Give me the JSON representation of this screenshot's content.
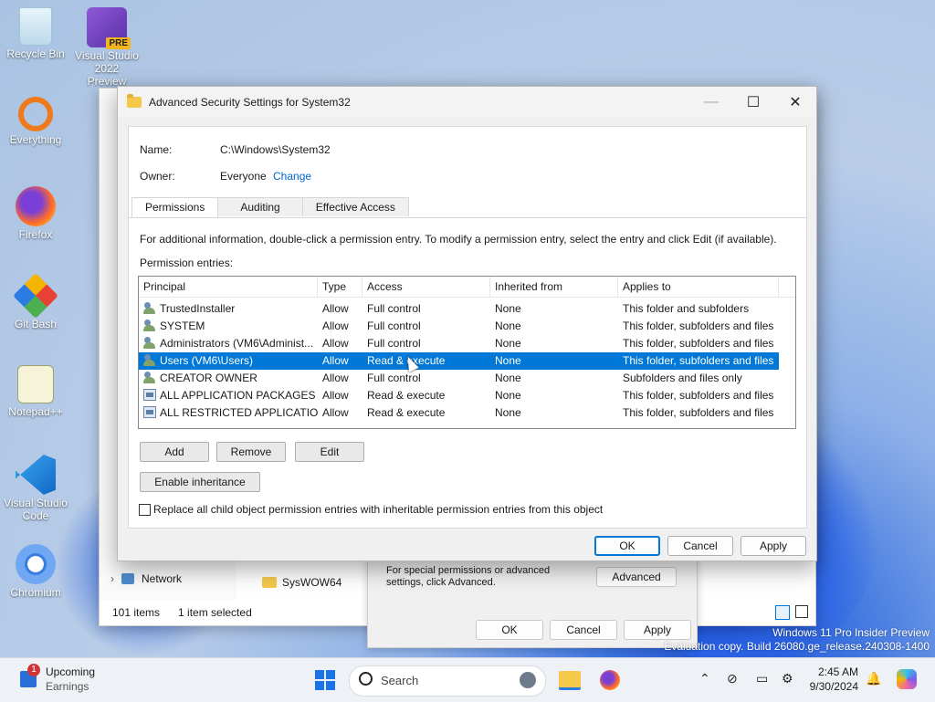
{
  "desktop": {
    "icons": [
      {
        "label": "Recycle Bin",
        "icon": "recycle-bin-icon"
      },
      {
        "label": "Visual Studio 2022 Preview",
        "icon": "visual-studio-icon",
        "badge": "PRE"
      },
      {
        "label": "Everything",
        "icon": "everything-search-icon"
      },
      {
        "label": "Firefox",
        "icon": "firefox-icon"
      },
      {
        "label": "Git Bash",
        "icon": "git-bash-icon"
      },
      {
        "label": "Notepad++",
        "icon": "notepad-plus-plus-icon"
      },
      {
        "label": "Visual Studio Code",
        "icon": "vscode-icon"
      },
      {
        "label": "Chromium",
        "icon": "chromium-icon"
      }
    ],
    "watermark_line1": "Windows 11 Pro Insider Preview",
    "watermark_line2": "Evaluation copy. Build 26080.ge_release.240308-1400"
  },
  "explorer": {
    "nav_network": "Network",
    "folder_item": "SysWOW64",
    "status_items": "101 items",
    "status_selected": "1 item selected"
  },
  "properties": {
    "hint": "For special permissions or advanced settings, click Advanced.",
    "advanced_label": "Advanced",
    "ok_label": "OK",
    "cancel_label": "Cancel",
    "apply_label": "Apply"
  },
  "dialog": {
    "title": "Advanced Security Settings for System32",
    "name_label": "Name:",
    "name_value": "C:\\Windows\\System32",
    "owner_label": "Owner:",
    "owner_value": "Everyone",
    "change_link": "Change",
    "tabs": [
      {
        "label": "Permissions",
        "active": true
      },
      {
        "label": "Auditing",
        "active": false
      },
      {
        "label": "Effective Access",
        "active": false
      }
    ],
    "info_text": "For additional information, double-click a permission entry. To modify a permission entry, select the entry and click Edit (if available).",
    "entries_label": "Permission entries:",
    "columns": [
      "Principal",
      "Type",
      "Access",
      "Inherited from",
      "Applies to"
    ],
    "rows": [
      {
        "principal": "TrustedInstaller",
        "type": "Allow",
        "access": "Full control",
        "inherited": "None",
        "applies": "This folder and subfolders",
        "icon": "user-group-icon"
      },
      {
        "principal": "SYSTEM",
        "type": "Allow",
        "access": "Full control",
        "inherited": "None",
        "applies": "This folder, subfolders and files",
        "icon": "user-group-icon"
      },
      {
        "principal": "Administrators (VM6\\Administ...",
        "type": "Allow",
        "access": "Full control",
        "inherited": "None",
        "applies": "This folder, subfolders and files",
        "icon": "user-group-icon"
      },
      {
        "principal": "Users (VM6\\Users)",
        "type": "Allow",
        "access": "Read & execute",
        "inherited": "None",
        "applies": "This folder, subfolders and files",
        "icon": "user-group-icon",
        "selected": true
      },
      {
        "principal": "CREATOR OWNER",
        "type": "Allow",
        "access": "Full control",
        "inherited": "None",
        "applies": "Subfolders and files only",
        "icon": "user-group-icon"
      },
      {
        "principal": "ALL APPLICATION PACKAGES",
        "type": "Allow",
        "access": "Read & execute",
        "inherited": "None",
        "applies": "This folder, subfolders and files",
        "icon": "package-icon"
      },
      {
        "principal": "ALL RESTRICTED APPLICATIO...",
        "type": "Allow",
        "access": "Read & execute",
        "inherited": "None",
        "applies": "This folder, subfolders and files",
        "icon": "package-icon"
      }
    ],
    "add_label": "Add",
    "remove_label": "Remove",
    "edit_label": "Edit",
    "enable_inheritance_label": "Enable inheritance",
    "replace_label": "Replace all child object permission entries with inheritable permission entries from this object",
    "ok_label": "OK",
    "cancel_label": "Cancel",
    "apply_label": "Apply"
  },
  "taskbar": {
    "widget_title": "Upcoming",
    "widget_sub": "Earnings",
    "widget_badge": "1",
    "search_placeholder": "Search",
    "time": "2:45 AM",
    "date": "9/30/2024",
    "accent": "#0078d7"
  }
}
